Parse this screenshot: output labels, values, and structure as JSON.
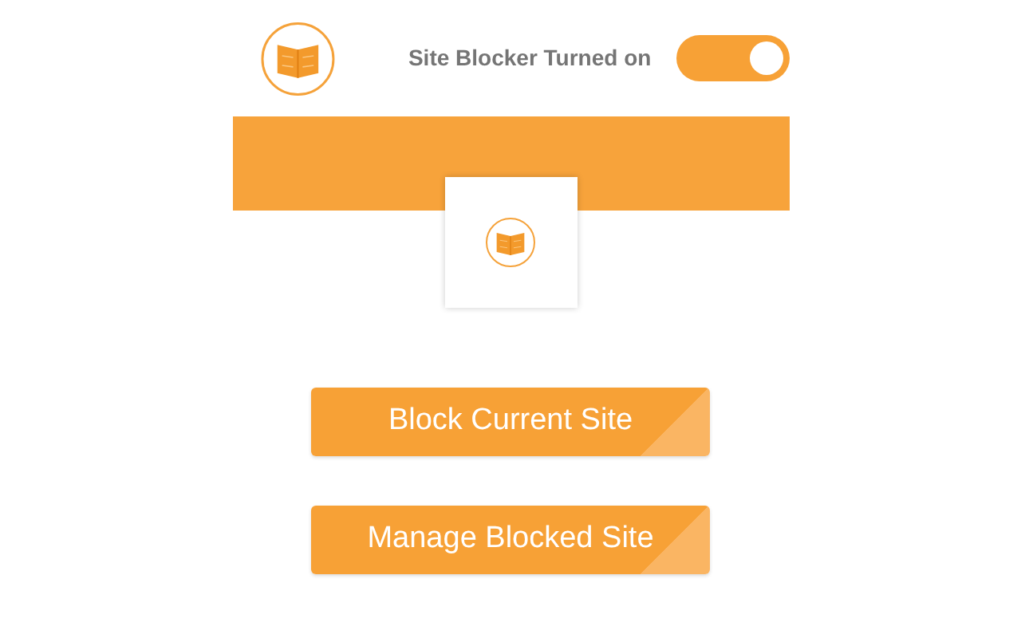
{
  "header": {
    "status": "Site Blocker Turned on",
    "toggle": {
      "on": true
    }
  },
  "buttons": [
    "Block Current Site",
    "Manage Blocked Site"
  ]
}
